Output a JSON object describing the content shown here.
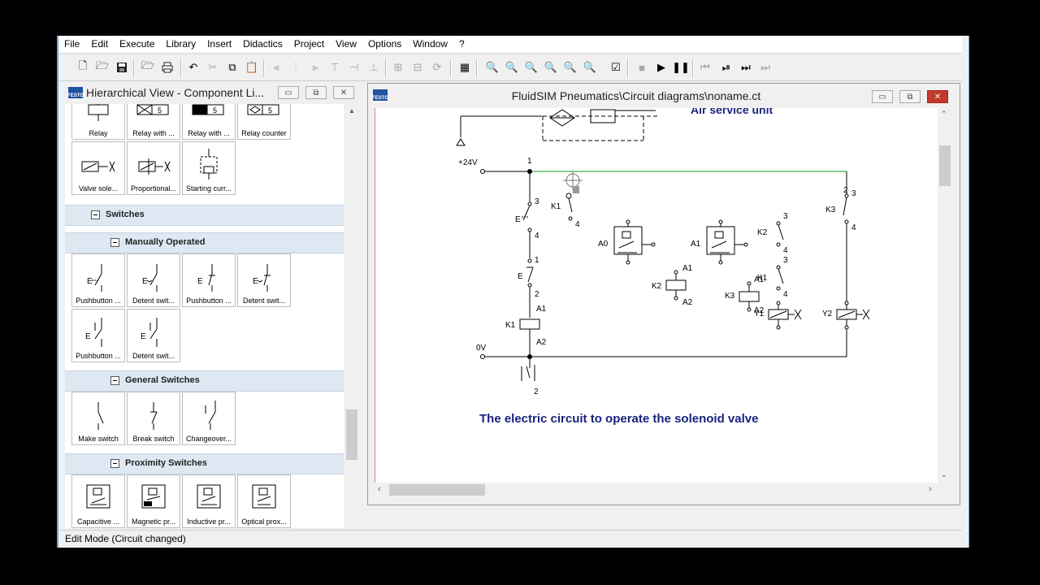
{
  "menu": [
    "File",
    "Edit",
    "Execute",
    "Library",
    "Insert",
    "Didactics",
    "Project",
    "View",
    "Options",
    "Window",
    "?"
  ],
  "library": {
    "title": "Hierarchical View - Component Li...",
    "top_row": [
      "Relay",
      "Relay with ...",
      "Relay with ...",
      "Relay counter"
    ],
    "second_row": [
      "Valve sole...",
      "Proportional...",
      "Starting curr..."
    ],
    "cat_switches": "Switches",
    "cat_manual": "Manually Operated",
    "manual_row1": [
      "Pushbutton ...",
      "Detent swit...",
      "Pushbutton ...",
      "Detent swit..."
    ],
    "manual_row2": [
      "Pushbutton ...",
      "Detent swit..."
    ],
    "cat_general": "General Switches",
    "general_row": [
      "Make switch",
      "Break switch",
      "Changeover..."
    ],
    "cat_proximity": "Proximity Switches",
    "prox_row": [
      "Capacitive ...",
      "Magnetic pr...",
      "Inductive pr...",
      "Optical prox..."
    ]
  },
  "circuit_window": {
    "title": "FluidSIM Pneumatics\\Circuit diagrams\\noname.ct",
    "caption": "The electric circuit to operate the solenoid valve",
    "top_label": "Air service unit",
    "labels": {
      "v24": "+24V",
      "v0": "0V",
      "n1": "1",
      "n3": "3",
      "n4": "4",
      "n2": "2",
      "a1": "A1",
      "a2": "A2",
      "k1": "K1",
      "k2": "K2",
      "k3": "K3",
      "a0": "A0",
      "a1b": "A1",
      "y1": "Y1",
      "y2": "Y2",
      "b": "3"
    }
  },
  "status": "Edit Mode (Circuit changed)"
}
